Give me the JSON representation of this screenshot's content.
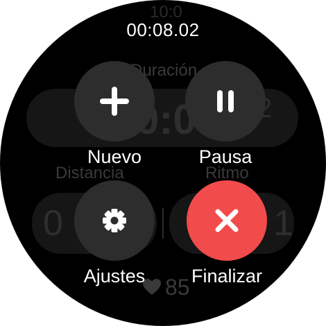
{
  "status_bar": {
    "elapsed_time": "00:08.02"
  },
  "background": {
    "top_label": "10:0",
    "duration_label": "Duración",
    "duration_value_left": "0",
    "duration_value": "0:0",
    "duration_value_right": "2",
    "distance_label": "Distancia",
    "pace_label": "Ritmo",
    "distance_value": "0",
    "pace_value": "1",
    "heart_rate": "85"
  },
  "actions": {
    "new": {
      "label": "Nuevo",
      "icon": "plus-icon"
    },
    "pause": {
      "label": "Pausa",
      "icon": "pause-icon"
    },
    "settings": {
      "label": "Ajustes",
      "icon": "gear-icon"
    },
    "finish": {
      "label": "Finalizar",
      "icon": "close-icon"
    }
  },
  "colors": {
    "button_bg": "#2d2d2d",
    "finish_bg": "#f24b4b",
    "text": "#ffffff"
  }
}
